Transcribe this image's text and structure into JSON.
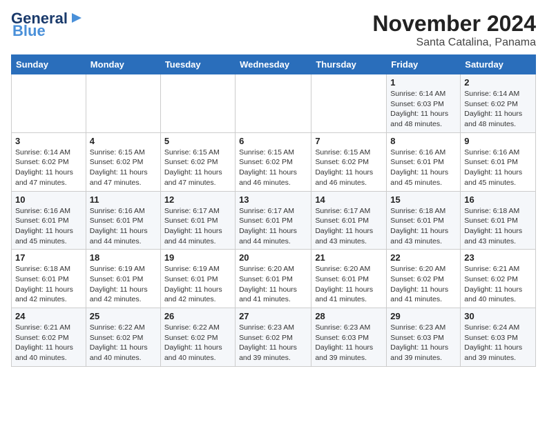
{
  "logo": {
    "line1": "General",
    "line2": "Blue"
  },
  "title": "November 2024",
  "subtitle": "Santa Catalina, Panama",
  "days_header": [
    "Sunday",
    "Monday",
    "Tuesday",
    "Wednesday",
    "Thursday",
    "Friday",
    "Saturday"
  ],
  "weeks": [
    [
      {
        "day": "",
        "detail": ""
      },
      {
        "day": "",
        "detail": ""
      },
      {
        "day": "",
        "detail": ""
      },
      {
        "day": "",
        "detail": ""
      },
      {
        "day": "",
        "detail": ""
      },
      {
        "day": "1",
        "detail": "Sunrise: 6:14 AM\nSunset: 6:03 PM\nDaylight: 11 hours\nand 48 minutes."
      },
      {
        "day": "2",
        "detail": "Sunrise: 6:14 AM\nSunset: 6:02 PM\nDaylight: 11 hours\nand 48 minutes."
      }
    ],
    [
      {
        "day": "3",
        "detail": "Sunrise: 6:14 AM\nSunset: 6:02 PM\nDaylight: 11 hours\nand 47 minutes."
      },
      {
        "day": "4",
        "detail": "Sunrise: 6:15 AM\nSunset: 6:02 PM\nDaylight: 11 hours\nand 47 minutes."
      },
      {
        "day": "5",
        "detail": "Sunrise: 6:15 AM\nSunset: 6:02 PM\nDaylight: 11 hours\nand 47 minutes."
      },
      {
        "day": "6",
        "detail": "Sunrise: 6:15 AM\nSunset: 6:02 PM\nDaylight: 11 hours\nand 46 minutes."
      },
      {
        "day": "7",
        "detail": "Sunrise: 6:15 AM\nSunset: 6:02 PM\nDaylight: 11 hours\nand 46 minutes."
      },
      {
        "day": "8",
        "detail": "Sunrise: 6:16 AM\nSunset: 6:01 PM\nDaylight: 11 hours\nand 45 minutes."
      },
      {
        "day": "9",
        "detail": "Sunrise: 6:16 AM\nSunset: 6:01 PM\nDaylight: 11 hours\nand 45 minutes."
      }
    ],
    [
      {
        "day": "10",
        "detail": "Sunrise: 6:16 AM\nSunset: 6:01 PM\nDaylight: 11 hours\nand 45 minutes."
      },
      {
        "day": "11",
        "detail": "Sunrise: 6:16 AM\nSunset: 6:01 PM\nDaylight: 11 hours\nand 44 minutes."
      },
      {
        "day": "12",
        "detail": "Sunrise: 6:17 AM\nSunset: 6:01 PM\nDaylight: 11 hours\nand 44 minutes."
      },
      {
        "day": "13",
        "detail": "Sunrise: 6:17 AM\nSunset: 6:01 PM\nDaylight: 11 hours\nand 44 minutes."
      },
      {
        "day": "14",
        "detail": "Sunrise: 6:17 AM\nSunset: 6:01 PM\nDaylight: 11 hours\nand 43 minutes."
      },
      {
        "day": "15",
        "detail": "Sunrise: 6:18 AM\nSunset: 6:01 PM\nDaylight: 11 hours\nand 43 minutes."
      },
      {
        "day": "16",
        "detail": "Sunrise: 6:18 AM\nSunset: 6:01 PM\nDaylight: 11 hours\nand 43 minutes."
      }
    ],
    [
      {
        "day": "17",
        "detail": "Sunrise: 6:18 AM\nSunset: 6:01 PM\nDaylight: 11 hours\nand 42 minutes."
      },
      {
        "day": "18",
        "detail": "Sunrise: 6:19 AM\nSunset: 6:01 PM\nDaylight: 11 hours\nand 42 minutes."
      },
      {
        "day": "19",
        "detail": "Sunrise: 6:19 AM\nSunset: 6:01 PM\nDaylight: 11 hours\nand 42 minutes."
      },
      {
        "day": "20",
        "detail": "Sunrise: 6:20 AM\nSunset: 6:01 PM\nDaylight: 11 hours\nand 41 minutes."
      },
      {
        "day": "21",
        "detail": "Sunrise: 6:20 AM\nSunset: 6:01 PM\nDaylight: 11 hours\nand 41 minutes."
      },
      {
        "day": "22",
        "detail": "Sunrise: 6:20 AM\nSunset: 6:02 PM\nDaylight: 11 hours\nand 41 minutes."
      },
      {
        "day": "23",
        "detail": "Sunrise: 6:21 AM\nSunset: 6:02 PM\nDaylight: 11 hours\nand 40 minutes."
      }
    ],
    [
      {
        "day": "24",
        "detail": "Sunrise: 6:21 AM\nSunset: 6:02 PM\nDaylight: 11 hours\nand 40 minutes."
      },
      {
        "day": "25",
        "detail": "Sunrise: 6:22 AM\nSunset: 6:02 PM\nDaylight: 11 hours\nand 40 minutes."
      },
      {
        "day": "26",
        "detail": "Sunrise: 6:22 AM\nSunset: 6:02 PM\nDaylight: 11 hours\nand 40 minutes."
      },
      {
        "day": "27",
        "detail": "Sunrise: 6:23 AM\nSunset: 6:02 PM\nDaylight: 11 hours\nand 39 minutes."
      },
      {
        "day": "28",
        "detail": "Sunrise: 6:23 AM\nSunset: 6:03 PM\nDaylight: 11 hours\nand 39 minutes."
      },
      {
        "day": "29",
        "detail": "Sunrise: 6:23 AM\nSunset: 6:03 PM\nDaylight: 11 hours\nand 39 minutes."
      },
      {
        "day": "30",
        "detail": "Sunrise: 6:24 AM\nSunset: 6:03 PM\nDaylight: 11 hours\nand 39 minutes."
      }
    ]
  ]
}
